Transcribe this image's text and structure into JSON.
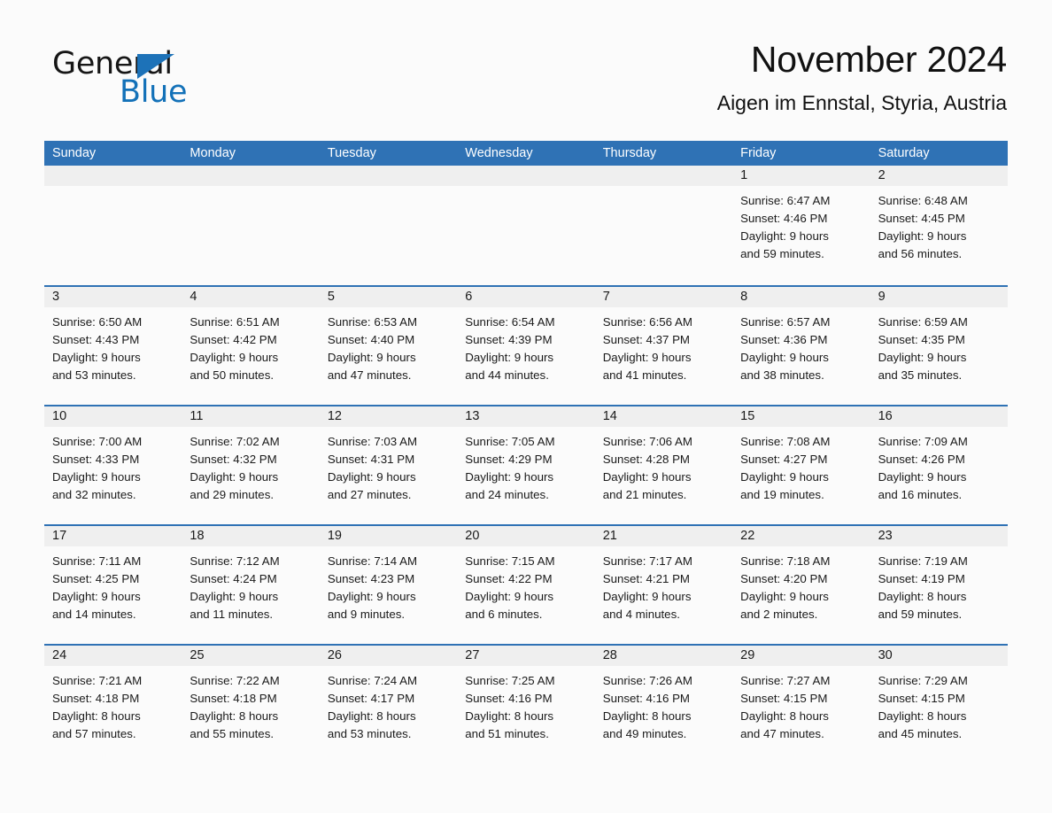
{
  "brand": {
    "word_one": "General",
    "word_two": "Blue",
    "triangle_color": "#1d72b8",
    "blue_text_color": "#1371b8"
  },
  "header": {
    "title": "November 2024",
    "subtitle": "Aigen im Ennstal, Styria, Austria",
    "header_bar_color": "#2f72b5",
    "day_band_color": "#efefef"
  },
  "calendar": {
    "weekdays": [
      "Sunday",
      "Monday",
      "Tuesday",
      "Wednesday",
      "Thursday",
      "Friday",
      "Saturday"
    ],
    "weeks": [
      [
        {
          "day": "",
          "sunrise": "",
          "sunset": "",
          "daylight_line1": "",
          "daylight_line2": ""
        },
        {
          "day": "",
          "sunrise": "",
          "sunset": "",
          "daylight_line1": "",
          "daylight_line2": ""
        },
        {
          "day": "",
          "sunrise": "",
          "sunset": "",
          "daylight_line1": "",
          "daylight_line2": ""
        },
        {
          "day": "",
          "sunrise": "",
          "sunset": "",
          "daylight_line1": "",
          "daylight_line2": ""
        },
        {
          "day": "",
          "sunrise": "",
          "sunset": "",
          "daylight_line1": "",
          "daylight_line2": ""
        },
        {
          "day": "1",
          "sunrise": "Sunrise: 6:47 AM",
          "sunset": "Sunset: 4:46 PM",
          "daylight_line1": "Daylight: 9 hours",
          "daylight_line2": "and 59 minutes."
        },
        {
          "day": "2",
          "sunrise": "Sunrise: 6:48 AM",
          "sunset": "Sunset: 4:45 PM",
          "daylight_line1": "Daylight: 9 hours",
          "daylight_line2": "and 56 minutes."
        }
      ],
      [
        {
          "day": "3",
          "sunrise": "Sunrise: 6:50 AM",
          "sunset": "Sunset: 4:43 PM",
          "daylight_line1": "Daylight: 9 hours",
          "daylight_line2": "and 53 minutes."
        },
        {
          "day": "4",
          "sunrise": "Sunrise: 6:51 AM",
          "sunset": "Sunset: 4:42 PM",
          "daylight_line1": "Daylight: 9 hours",
          "daylight_line2": "and 50 minutes."
        },
        {
          "day": "5",
          "sunrise": "Sunrise: 6:53 AM",
          "sunset": "Sunset: 4:40 PM",
          "daylight_line1": "Daylight: 9 hours",
          "daylight_line2": "and 47 minutes."
        },
        {
          "day": "6",
          "sunrise": "Sunrise: 6:54 AM",
          "sunset": "Sunset: 4:39 PM",
          "daylight_line1": "Daylight: 9 hours",
          "daylight_line2": "and 44 minutes."
        },
        {
          "day": "7",
          "sunrise": "Sunrise: 6:56 AM",
          "sunset": "Sunset: 4:37 PM",
          "daylight_line1": "Daylight: 9 hours",
          "daylight_line2": "and 41 minutes."
        },
        {
          "day": "8",
          "sunrise": "Sunrise: 6:57 AM",
          "sunset": "Sunset: 4:36 PM",
          "daylight_line1": "Daylight: 9 hours",
          "daylight_line2": "and 38 minutes."
        },
        {
          "day": "9",
          "sunrise": "Sunrise: 6:59 AM",
          "sunset": "Sunset: 4:35 PM",
          "daylight_line1": "Daylight: 9 hours",
          "daylight_line2": "and 35 minutes."
        }
      ],
      [
        {
          "day": "10",
          "sunrise": "Sunrise: 7:00 AM",
          "sunset": "Sunset: 4:33 PM",
          "daylight_line1": "Daylight: 9 hours",
          "daylight_line2": "and 32 minutes."
        },
        {
          "day": "11",
          "sunrise": "Sunrise: 7:02 AM",
          "sunset": "Sunset: 4:32 PM",
          "daylight_line1": "Daylight: 9 hours",
          "daylight_line2": "and 29 minutes."
        },
        {
          "day": "12",
          "sunrise": "Sunrise: 7:03 AM",
          "sunset": "Sunset: 4:31 PM",
          "daylight_line1": "Daylight: 9 hours",
          "daylight_line2": "and 27 minutes."
        },
        {
          "day": "13",
          "sunrise": "Sunrise: 7:05 AM",
          "sunset": "Sunset: 4:29 PM",
          "daylight_line1": "Daylight: 9 hours",
          "daylight_line2": "and 24 minutes."
        },
        {
          "day": "14",
          "sunrise": "Sunrise: 7:06 AM",
          "sunset": "Sunset: 4:28 PM",
          "daylight_line1": "Daylight: 9 hours",
          "daylight_line2": "and 21 minutes."
        },
        {
          "day": "15",
          "sunrise": "Sunrise: 7:08 AM",
          "sunset": "Sunset: 4:27 PM",
          "daylight_line1": "Daylight: 9 hours",
          "daylight_line2": "and 19 minutes."
        },
        {
          "day": "16",
          "sunrise": "Sunrise: 7:09 AM",
          "sunset": "Sunset: 4:26 PM",
          "daylight_line1": "Daylight: 9 hours",
          "daylight_line2": "and 16 minutes."
        }
      ],
      [
        {
          "day": "17",
          "sunrise": "Sunrise: 7:11 AM",
          "sunset": "Sunset: 4:25 PM",
          "daylight_line1": "Daylight: 9 hours",
          "daylight_line2": "and 14 minutes."
        },
        {
          "day": "18",
          "sunrise": "Sunrise: 7:12 AM",
          "sunset": "Sunset: 4:24 PM",
          "daylight_line1": "Daylight: 9 hours",
          "daylight_line2": "and 11 minutes."
        },
        {
          "day": "19",
          "sunrise": "Sunrise: 7:14 AM",
          "sunset": "Sunset: 4:23 PM",
          "daylight_line1": "Daylight: 9 hours",
          "daylight_line2": "and 9 minutes."
        },
        {
          "day": "20",
          "sunrise": "Sunrise: 7:15 AM",
          "sunset": "Sunset: 4:22 PM",
          "daylight_line1": "Daylight: 9 hours",
          "daylight_line2": "and 6 minutes."
        },
        {
          "day": "21",
          "sunrise": "Sunrise: 7:17 AM",
          "sunset": "Sunset: 4:21 PM",
          "daylight_line1": "Daylight: 9 hours",
          "daylight_line2": "and 4 minutes."
        },
        {
          "day": "22",
          "sunrise": "Sunrise: 7:18 AM",
          "sunset": "Sunset: 4:20 PM",
          "daylight_line1": "Daylight: 9 hours",
          "daylight_line2": "and 2 minutes."
        },
        {
          "day": "23",
          "sunrise": "Sunrise: 7:19 AM",
          "sunset": "Sunset: 4:19 PM",
          "daylight_line1": "Daylight: 8 hours",
          "daylight_line2": "and 59 minutes."
        }
      ],
      [
        {
          "day": "24",
          "sunrise": "Sunrise: 7:21 AM",
          "sunset": "Sunset: 4:18 PM",
          "daylight_line1": "Daylight: 8 hours",
          "daylight_line2": "and 57 minutes."
        },
        {
          "day": "25",
          "sunrise": "Sunrise: 7:22 AM",
          "sunset": "Sunset: 4:18 PM",
          "daylight_line1": "Daylight: 8 hours",
          "daylight_line2": "and 55 minutes."
        },
        {
          "day": "26",
          "sunrise": "Sunrise: 7:24 AM",
          "sunset": "Sunset: 4:17 PM",
          "daylight_line1": "Daylight: 8 hours",
          "daylight_line2": "and 53 minutes."
        },
        {
          "day": "27",
          "sunrise": "Sunrise: 7:25 AM",
          "sunset": "Sunset: 4:16 PM",
          "daylight_line1": "Daylight: 8 hours",
          "daylight_line2": "and 51 minutes."
        },
        {
          "day": "28",
          "sunrise": "Sunrise: 7:26 AM",
          "sunset": "Sunset: 4:16 PM",
          "daylight_line1": "Daylight: 8 hours",
          "daylight_line2": "and 49 minutes."
        },
        {
          "day": "29",
          "sunrise": "Sunrise: 7:27 AM",
          "sunset": "Sunset: 4:15 PM",
          "daylight_line1": "Daylight: 8 hours",
          "daylight_line2": "and 47 minutes."
        },
        {
          "day": "30",
          "sunrise": "Sunrise: 7:29 AM",
          "sunset": "Sunset: 4:15 PM",
          "daylight_line1": "Daylight: 8 hours",
          "daylight_line2": "and 45 minutes."
        }
      ]
    ]
  }
}
